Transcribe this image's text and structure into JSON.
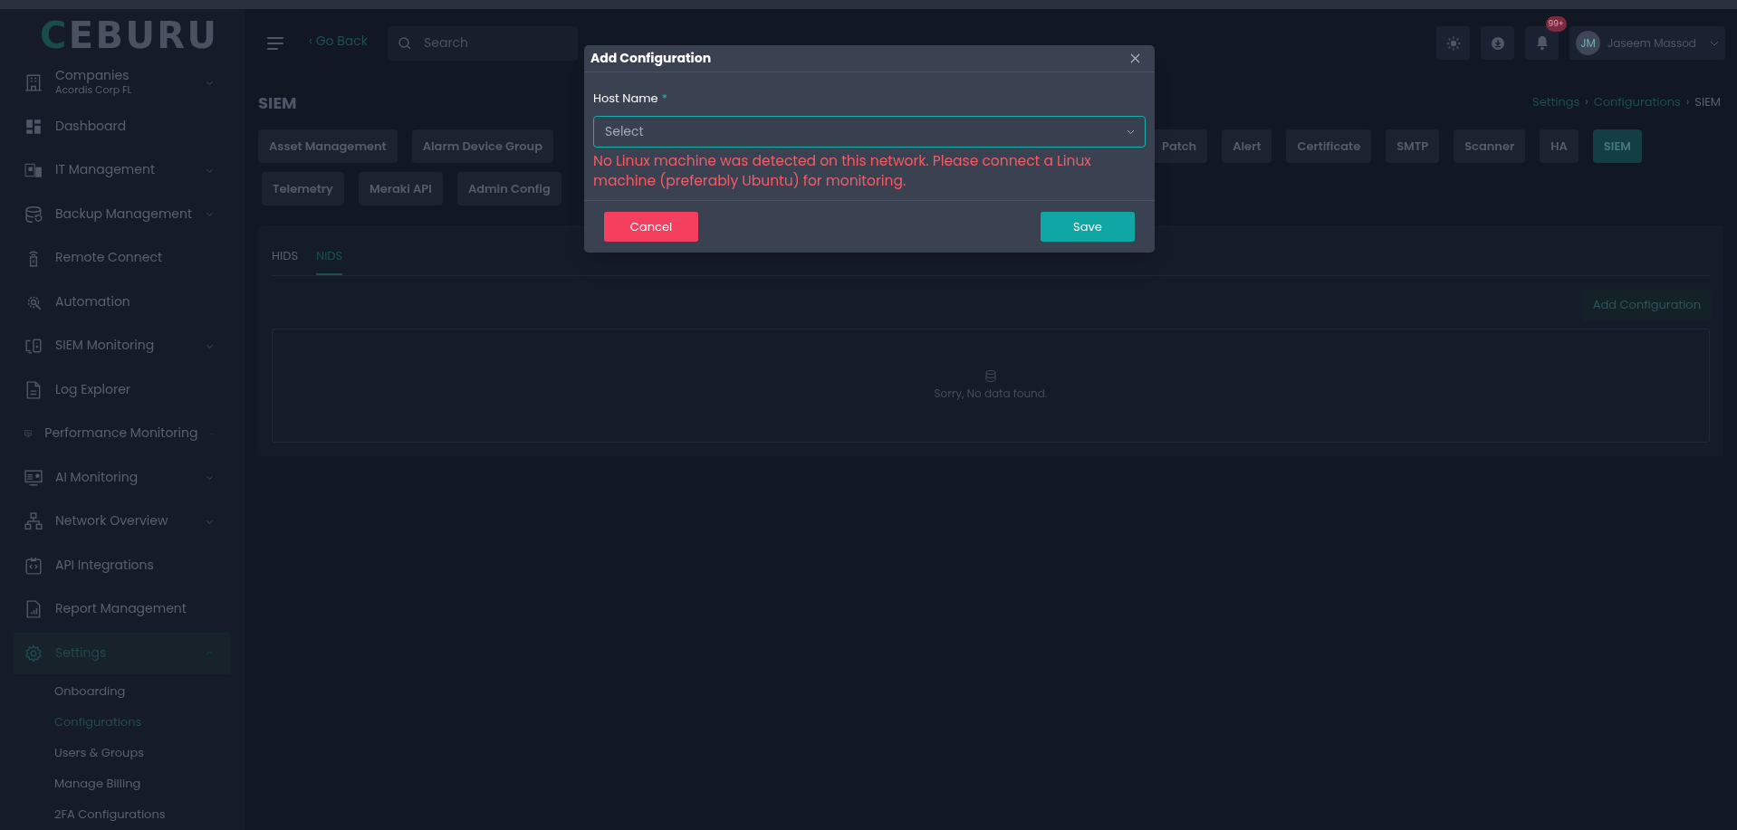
{
  "logo": {
    "text": "CEBURU"
  },
  "sidebar": {
    "items": [
      {
        "label": "Companies",
        "sublabel": "Acordis Corp FL",
        "expanded": false,
        "selected": false
      },
      {
        "label": "Dashboard",
        "selected": false
      },
      {
        "label": "IT Management",
        "expanded": false,
        "selected": false
      },
      {
        "label": "Backup Management",
        "expanded": false,
        "selected": false
      },
      {
        "label": "Remote Connect",
        "selected": false
      },
      {
        "label": "Automation",
        "selected": false
      },
      {
        "label": "SIEM Monitoring",
        "expanded": false,
        "selected": false
      },
      {
        "label": "Log Explorer",
        "selected": false
      },
      {
        "label": "Performance Monitoring",
        "expanded": false,
        "selected": false
      },
      {
        "label": "AI Monitoring",
        "expanded": false,
        "selected": false
      },
      {
        "label": "Network Overview",
        "expanded": false,
        "selected": false
      },
      {
        "label": "API Integrations",
        "selected": false
      },
      {
        "label": "Report Management",
        "selected": false
      },
      {
        "label": "Settings",
        "expanded": true,
        "selected": true,
        "children": [
          {
            "label": "Onboarding",
            "selected": false
          },
          {
            "label": "Configurations",
            "selected": true
          },
          {
            "label": "Users & Groups",
            "selected": false
          },
          {
            "label": "Manage Billing",
            "selected": false
          },
          {
            "label": "2FA Configurations",
            "selected": false
          }
        ]
      }
    ]
  },
  "header": {
    "back_link": "‹ Go Back",
    "search": {
      "placeholder": "Search"
    },
    "notifications_badge": "99+",
    "user": {
      "initials": "JM",
      "name": "Jaseem Massod"
    }
  },
  "page": {
    "title": "SIEM",
    "breadcrumbs": [
      "Settings",
      "Configurations",
      "SIEM"
    ],
    "breadcrumb_separators": [
      "›",
      "›"
    ],
    "config_tabs_row_1": [
      {
        "label": "Asset Management",
        "selected": false
      },
      {
        "label": "Alarm Device Group",
        "selected": false
      },
      {
        "label": "Patch",
        "selected": false
      },
      {
        "label": "Alert",
        "selected": false
      },
      {
        "label": "Certificate",
        "selected": false
      },
      {
        "label": "SMTP",
        "selected": false
      },
      {
        "label": "Scanner",
        "selected": false
      },
      {
        "label": "HA",
        "selected": false
      },
      {
        "label": "SIEM",
        "selected": true
      }
    ],
    "config_tabs_row_2": [
      {
        "label": "Telemetry",
        "selected": false
      },
      {
        "label": "Meraki API",
        "selected": false
      },
      {
        "label": "Admin Config",
        "selected": false
      }
    ],
    "card": {
      "tabs": [
        {
          "label": "HIDS",
          "selected": false
        },
        {
          "label": "NIDS",
          "selected": true
        }
      ],
      "add_button": "Add Configuration",
      "empty_message": "Sorry, No data found."
    }
  },
  "modal": {
    "title": "Add Configuration",
    "field": {
      "label": "Host Name",
      "required_mark": "*",
      "placeholder": "Select"
    },
    "error": "No Linux machine was detected on this network. Please connect a Linux machine (preferably Ubuntu) for monitoring.",
    "cancel": "Cancel",
    "save": "Save"
  }
}
